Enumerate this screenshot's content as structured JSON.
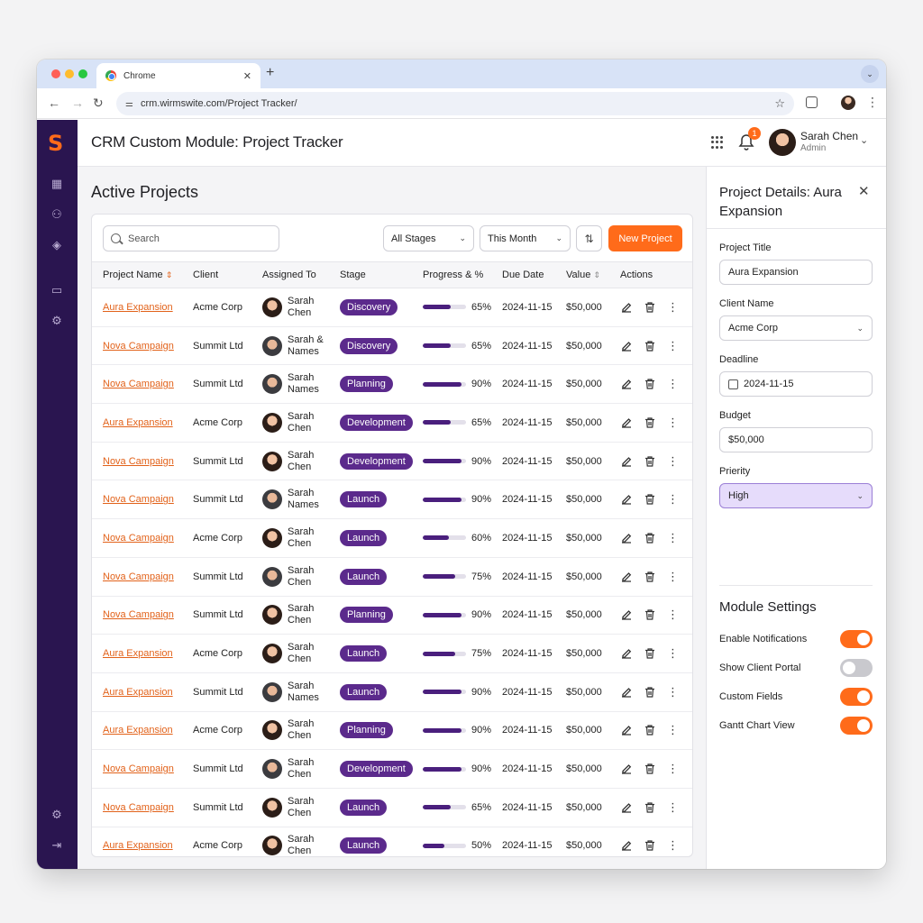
{
  "browser": {
    "tab_title": "Chrome",
    "url": "crm.wirmswite.com/Project Tracker/"
  },
  "header": {
    "title": "CRM Custom Module: Project Tracker",
    "notification_count": "1",
    "user_name": "Sarah Chen",
    "user_role": "Admin"
  },
  "main": {
    "page_title": "Active Projects",
    "search_placeholder": "Search",
    "stage_filter": "All Stages",
    "period_filter": "This Month",
    "new_project_label": "New Project",
    "columns": [
      "Project Name",
      "Client",
      "Assigned To",
      "Stage",
      "Progress & %",
      "Due Date",
      "Value",
      "Actions"
    ],
    "rows": [
      {
        "project": "Aura Expansion",
        "client": "Acme Corp",
        "assignee": "Sarah Chen",
        "avatar": "f",
        "stage": "Discovery",
        "progress": 65,
        "progress_label": "65%",
        "due": "2024-11-15",
        "value": "$50,000"
      },
      {
        "project": "Nova Campaign",
        "client": "Summit Ltd",
        "assignee": "Sarah & Names",
        "avatar": "m",
        "stage": "Discovery",
        "progress": 65,
        "progress_label": "65%",
        "due": "2024-11-15",
        "value": "$50,000"
      },
      {
        "project": "Nova Campaign",
        "client": "Summit Ltd",
        "assignee": "Sarah Names",
        "avatar": "m",
        "stage": "Planning",
        "progress": 90,
        "progress_label": "90%",
        "due": "2024-11-15",
        "value": "$50,000"
      },
      {
        "project": "Aura Expansion",
        "client": "Acme Corp",
        "assignee": "Sarah Chen",
        "avatar": "f",
        "stage": "Development",
        "progress": 65,
        "progress_label": "65%",
        "due": "2024-11-15",
        "value": "$50,000"
      },
      {
        "project": "Nova Campaign",
        "client": "Summit Ltd",
        "assignee": "Sarah Chen",
        "avatar": "f",
        "stage": "Development",
        "progress": 90,
        "progress_label": "90%",
        "due": "2024-11-15",
        "value": "$50,000"
      },
      {
        "project": "Nova Campaign",
        "client": "Summit Ltd",
        "assignee": "Sarah Names",
        "avatar": "m",
        "stage": "Launch",
        "progress": 90,
        "progress_label": "90%",
        "due": "2024-11-15",
        "value": "$50,000"
      },
      {
        "project": "Nova Campaign",
        "client": "Acme Corp",
        "assignee": "Sarah Chen",
        "avatar": "f",
        "stage": "Launch",
        "progress": 60,
        "progress_label": "60%",
        "due": "2024-11-15",
        "value": "$50,000"
      },
      {
        "project": "Nova Campaign",
        "client": "Summit Ltd",
        "assignee": "Sarah Chen",
        "avatar": "m",
        "stage": "Launch",
        "progress": 75,
        "progress_label": "75%",
        "due": "2024-11-15",
        "value": "$50,000"
      },
      {
        "project": "Nova Campaign",
        "client": "Summit Ltd",
        "assignee": "Sarah Chen",
        "avatar": "f",
        "stage": "Planning",
        "progress": 90,
        "progress_label": "90%",
        "due": "2024-11-15",
        "value": "$50,000"
      },
      {
        "project": "Aura Expansion",
        "client": "Acme Corp",
        "assignee": "Sarah Chen",
        "avatar": "f",
        "stage": "Launch",
        "progress": 75,
        "progress_label": "75%",
        "due": "2024-11-15",
        "value": "$50,000"
      },
      {
        "project": "Aura Expansion",
        "client": "Summit Ltd",
        "assignee": "Sarah Names",
        "avatar": "m",
        "stage": "Launch",
        "progress": 90,
        "progress_label": "90%",
        "due": "2024-11-15",
        "value": "$50,000"
      },
      {
        "project": "Aura Expansion",
        "client": "Acme Corp",
        "assignee": "Sarah Chen",
        "avatar": "f",
        "stage": "Planning",
        "progress": 90,
        "progress_label": "90%",
        "due": "2024-11-15",
        "value": "$50,000"
      },
      {
        "project": "Nova Campaign",
        "client": "Summit Ltd",
        "assignee": "Sarah Chen",
        "avatar": "m",
        "stage": "Development",
        "progress": 90,
        "progress_label": "90%",
        "due": "2024-11-15",
        "value": "$50,000"
      },
      {
        "project": "Nova Campaign",
        "client": "Summit Ltd",
        "assignee": "Sarah Chen",
        "avatar": "f",
        "stage": "Launch",
        "progress": 65,
        "progress_label": "65%",
        "due": "2024-11-15",
        "value": "$50,000"
      },
      {
        "project": "Aura Expansion",
        "client": "Acme Corp",
        "assignee": "Sarah Chen",
        "avatar": "f",
        "stage": "Launch",
        "progress": 50,
        "progress_label": "50%",
        "due": "2024-11-15",
        "value": "$50,000"
      }
    ]
  },
  "details": {
    "title": "Project Details: Aura Expansion",
    "project_title_label": "Project Title",
    "project_title_value": "Aura Expansion",
    "client_label": "Client Name",
    "client_value": "Acme Corp",
    "deadline_label": "Deadline",
    "deadline_value": "2024-11-15",
    "budget_label": "Budget",
    "budget_value": "$50,000",
    "priority_label": "Prierity",
    "priority_value": "High",
    "settings_title": "Module Settings",
    "settings": [
      {
        "label": "Enable Notifications",
        "on": true
      },
      {
        "label": "Show Client Portal",
        "on": false
      },
      {
        "label": "Custom Fields",
        "on": true
      },
      {
        "label": "Gantt Chart View",
        "on": true
      }
    ]
  },
  "colors": {
    "accent": "#ff6b1a",
    "brand_purple": "#2a1550",
    "stage_badge": "#5b2a8c"
  }
}
